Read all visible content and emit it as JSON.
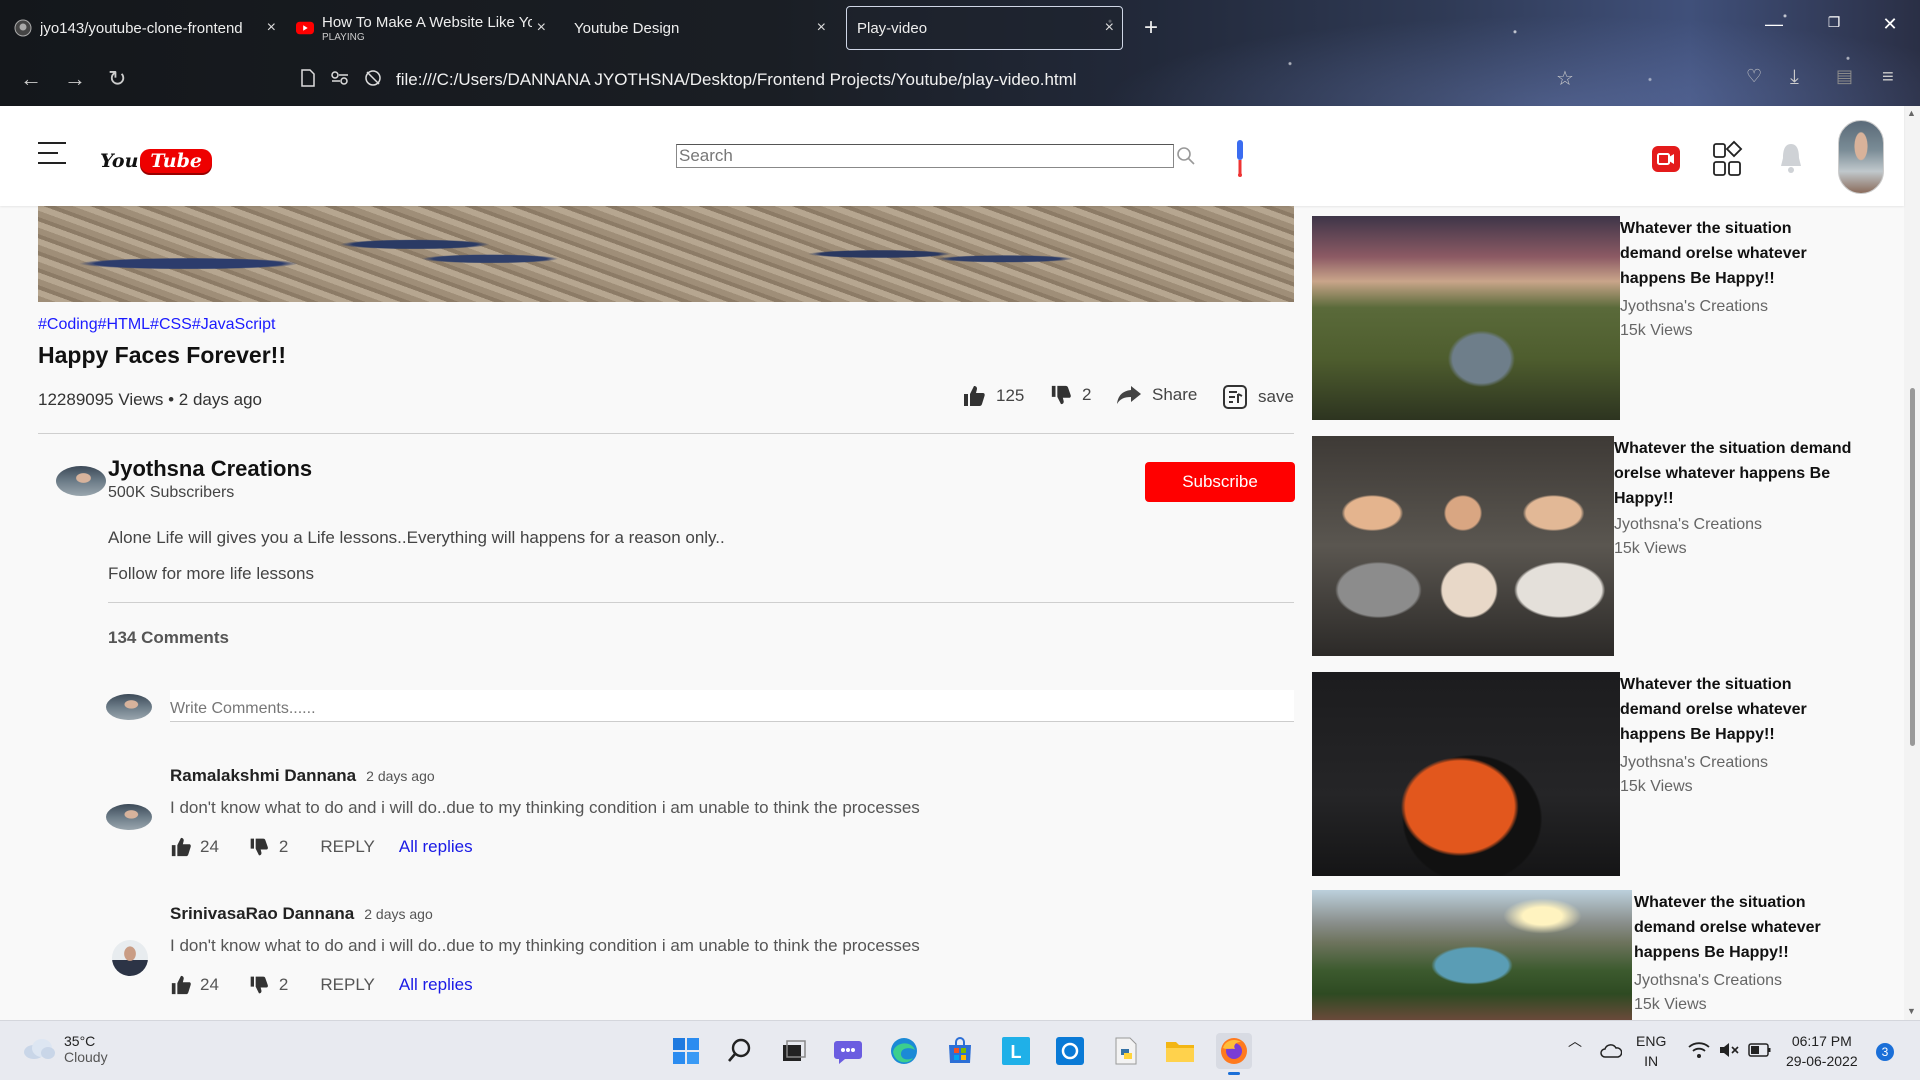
{
  "browser": {
    "tabs": [
      {
        "title": "jyo143/youtube-clone-frontend",
        "icon": "github-icon",
        "subtitle": ""
      },
      {
        "title": "How To Make A Website Like Yo",
        "icon": "youtube-icon",
        "subtitle": "PLAYING"
      },
      {
        "title": "Youtube Design",
        "icon": "",
        "subtitle": ""
      },
      {
        "title": "Play-video",
        "icon": "",
        "subtitle": ""
      }
    ],
    "url": "file:///C:/Users/DANNANA JYOTHSNA/Desktop/Frontend Projects/Youtube/play-video.html",
    "new_tab": "+",
    "close": "×"
  },
  "header": {
    "logo_you": "You",
    "logo_tube": "Tube",
    "search_placeholder": "Search"
  },
  "video": {
    "hashtags": "#Coding#HTML#CSS#JavaScript",
    "title": "Happy Faces Forever!!",
    "meta": "12289095 Views • 2 days ago",
    "likes": "125",
    "dislikes": "2",
    "share_label": "Share",
    "save_label": "save"
  },
  "channel": {
    "name": "Jyothsna Creations",
    "subscribers": "500K Subscribers",
    "subscribe_label": "Subscribe",
    "description": [
      "Alone Life will gives you a Life lessons..Everything will happens for a reason only..",
      "Follow for more life lessons"
    ]
  },
  "comments": {
    "count_label": "134 Comments",
    "write_placeholder": "Write Comments......",
    "items": [
      {
        "author": "Ramalakshmi Dannana",
        "time": "2 days ago",
        "text": "I don't know what to do and i will do..due to my thinking condition i am unable to think the processes",
        "likes": "24",
        "dislikes": "2",
        "reply": "REPLY",
        "all_replies": "All replies"
      },
      {
        "author": "SrinivasaRao Dannana",
        "time": "2 days ago",
        "text": "I don't know what to do and i will do..due to my thinking condition i am unable to think the processes",
        "likes": "24",
        "dislikes": "2",
        "reply": "REPLY",
        "all_replies": "All replies"
      }
    ]
  },
  "sidebar": {
    "items": [
      {
        "title_lines": [
          "Whatever the situation",
          "demand orelse whatever",
          "happens Be Happy!!"
        ],
        "channel": "Jyothsna's Creations",
        "views": "15k Views"
      },
      {
        "title_lines": [
          "Whatever the situation demand",
          "orelse whatever happens Be",
          "Happy!!"
        ],
        "channel": "Jyothsna's Creations",
        "views": "15k Views"
      },
      {
        "title_lines": [
          "Whatever the situation",
          "demand orelse whatever",
          "happens Be Happy!!"
        ],
        "channel": "Jyothsna's Creations",
        "views": "15k Views"
      },
      {
        "title_lines": [
          "Whatever the situation",
          "demand orelse whatever",
          "happens Be Happy!!"
        ],
        "channel": "Jyothsna's Creations",
        "views": "15k Views"
      }
    ]
  },
  "taskbar": {
    "weather_temp": "35°C",
    "weather_desc": "Cloudy",
    "lang_1": "ENG",
    "lang_2": "IN",
    "time": "06:17 PM",
    "date": "29-06-2022",
    "notifications": "3",
    "colors": {
      "accent": "#1a6fd8",
      "subscribe": "#ff0000",
      "link": "#1a1aff"
    }
  }
}
